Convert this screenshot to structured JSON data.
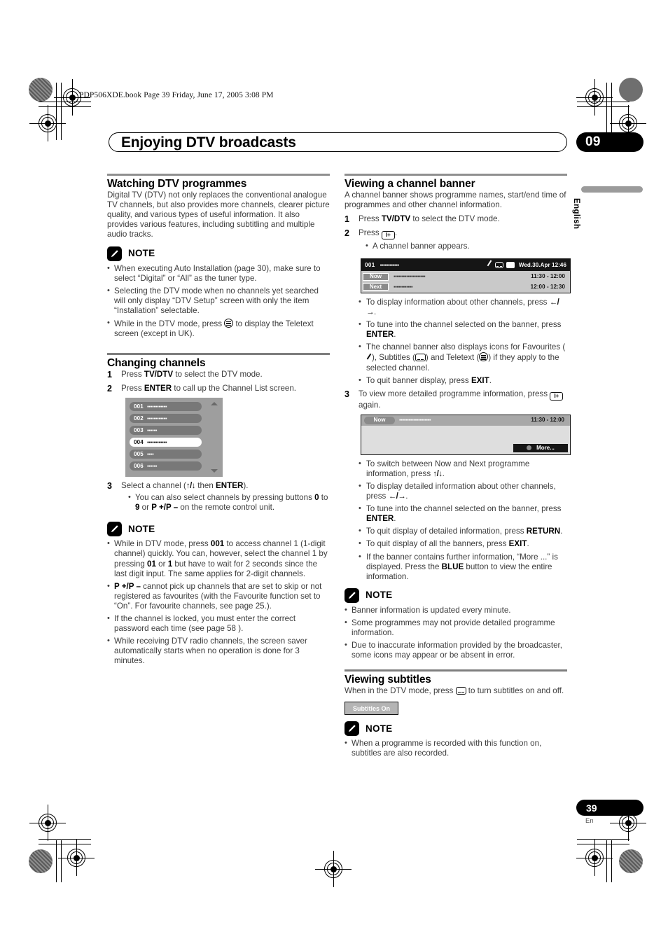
{
  "header": {
    "filestamp": "PDP506XDE.book  Page 39  Friday, June 17, 2005  3:08 PM",
    "chapter_title": "Enjoying DTV broadcasts",
    "chapter_number": "09",
    "language_tab": "English"
  },
  "footer": {
    "page_number": "39",
    "page_language": "En"
  },
  "left_column": {
    "watching": {
      "heading": "Watching DTV programmes",
      "intro": "Digital TV (DTV) not only replaces the conventional analogue TV channels, but also provides more channels, clearer picture quality, and various types of useful information. It also provides various features, including subtitling and multiple audio tracks.",
      "note_title": "NOTE",
      "notes": [
        "When executing Auto Installation (page 30), make sure to select “Digital” or “All” as the tuner type.",
        "Selecting the DTV mode when no channels yet searched will only display “DTV Setup” screen with only the item “Installation” selectable."
      ],
      "note_teletext_pre": "While in the DTV mode, press ",
      "note_teletext_post": " to display the Teletext screen (except in UK)."
    },
    "changing": {
      "heading": "Changing channels",
      "step1_num": "1",
      "step1_pre": "Press ",
      "step1_bold": "TV/DTV",
      "step1_post": " to select the DTV mode.",
      "step2_num": "2",
      "step2_pre": "Press ",
      "step2_bold": "ENTER",
      "step2_post": " to call up the Channel List screen.",
      "step3_num": "3",
      "step3_pre": "Select a channel (",
      "step3_arrows": "↑/↓",
      "step3_mid": " then ",
      "step3_bold": "ENTER",
      "step3_post": ").",
      "step3_bullet_a": "You can also select channels by pressing buttons ",
      "step3_bullet_b": "0",
      "step3_bullet_c": " to ",
      "step3_bullet_d": "9",
      "step3_bullet_e": " or ",
      "step3_bullet_f": "P +/P –",
      "step3_bullet_g": " on the remote control unit.",
      "note_title": "NOTE",
      "note1_a": "While in DTV mode, press ",
      "note1_b": "001",
      "note1_c": " to access channel 1 (1-digit channel) quickly. You can, however, select the channel 1 by pressing ",
      "note1_d": "01",
      "note1_e": " or ",
      "note1_f": "1",
      "note1_g": " but have to wait for 2 seconds since the last digit input. The same applies for 2-digit channels.",
      "note2_a": "P +/P –",
      "note2_b": " cannot pick up channels that are set to skip or not registered as favourites (with the Favourite function set to “On”. For favourite channels, see page 25.).",
      "note3": "If the channel is locked, you must enter the correct password each time (see page 58 ).",
      "note4": "While receiving DTV radio channels, the screen saver automatically starts when no operation is done for 3 minutes."
    },
    "channel_list_screen": {
      "rows": [
        {
          "number": "001",
          "name": "▪▪▪▪▪▪▪▪▪▪▪▪",
          "selected": false
        },
        {
          "number": "002",
          "name": "▪▪▪▪▪▪▪▪▪▪▪▪",
          "selected": false
        },
        {
          "number": "003",
          "name": "▪▪▪▪▪▪",
          "selected": false
        },
        {
          "number": "004",
          "name": "▪▪▪▪▪▪▪▪▪▪▪▪",
          "selected": true
        },
        {
          "number": "005",
          "name": "▪▪▪▪",
          "selected": false
        },
        {
          "number": "006",
          "name": "▪▪▪▪▪▪",
          "selected": false
        }
      ]
    }
  },
  "right_column": {
    "banner_section": {
      "heading": "Viewing a channel banner",
      "intro": "A channel banner shows programme names, start/end time of programmes and other channel information.",
      "step1_num": "1",
      "step1_pre": "Press ",
      "step1_bold": "TV/DTV",
      "step1_post": " to select the DTV mode.",
      "step2_num": "2",
      "step2_pre": "Press ",
      "step2_post": ".",
      "step2_bullet": "A channel banner appears.",
      "bullets_after_banner": [
        "To display information about other channels, press ",
        "To tune into the channel selected on the banner, press ",
        "To quit banner display, press "
      ],
      "bullet_enter_bold": "ENTER",
      "bullet_exit_bold": "EXIT",
      "bullet_icons_a": "The channel banner also displays icons for Favourites (",
      "bullet_icons_b": "), Subtitles (",
      "bullet_icons_c": ") and Teletext (",
      "bullet_icons_d": ") if they apply to the selected channel.",
      "step3_num": "3",
      "step3_pre": "To view more detailed programme information, press ",
      "step3_post": " again.",
      "detail_bullets": [
        {
          "a": "To switch between Now and Next programme information, press ",
          "arrows": "↑/↓",
          "b": "."
        },
        {
          "a": "To display detailed information about other channels, press ",
          "arrows": "←/→",
          "b": "."
        },
        {
          "a": "To tune into the channel selected on the banner, press ",
          "bold": "ENTER",
          "b": "."
        },
        {
          "a": "To quit display of detailed information, press ",
          "bold": "RETURN",
          "b": "."
        },
        {
          "a": "To quit display of all the banners, press ",
          "bold": "EXIT",
          "b": "."
        },
        {
          "a": "If the banner contains further information, “More ...” is displayed. Press the ",
          "bold": "BLUE",
          "b": " button to view the entire information."
        }
      ],
      "note_title": "NOTE",
      "notes": [
        "Banner information is updated every minute.",
        "Some programmes may not provide detailed programme information.",
        "Due to inaccurate information provided by the broadcaster, some icons may appear or be absent in error."
      ]
    },
    "channel_banner_screen": {
      "channel_number": "001",
      "channel_name": "▪▪▪▪▪▪▪▪▪▪▪▪",
      "datetime": "Wed.30.Apr 12:46",
      "rows": [
        {
          "tag": "Now",
          "name": "▪▪▪▪▪▪▪▪▪▪▪▪▪▪▪▪▪▪▪▪",
          "time": "11:30 - 12:00"
        },
        {
          "tag": "Next",
          "name": "▪▪▪▪▪▪▪▪▪▪▪▪",
          "time": "12:00 - 12:30"
        }
      ]
    },
    "detail_screen": {
      "tag": "Now",
      "name": "▪▪▪▪▪▪▪▪▪▪▪▪▪▪▪▪▪▪▪▪",
      "time": "11:30 - 12:00",
      "more_label": "More..."
    },
    "subtitles_section": {
      "heading": "Viewing subtitles",
      "intro_pre": "When in the DTV mode, press ",
      "intro_post": " to turn subtitles on and off.",
      "badge_label": "Subtitles On",
      "note_title": "NOTE",
      "note": "When a programme is recorded with this function on, subtitles are also recorded."
    }
  }
}
